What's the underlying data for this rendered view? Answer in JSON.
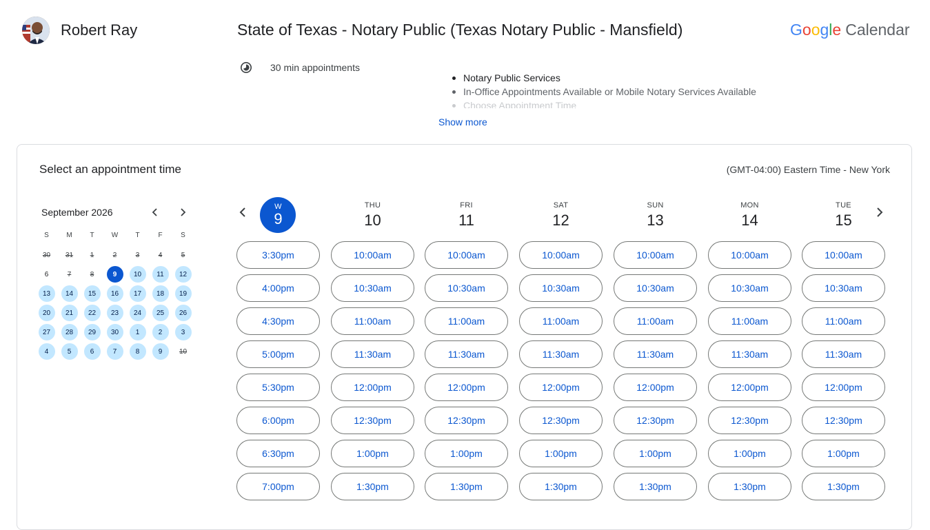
{
  "host": {
    "name": "Robert Ray"
  },
  "event": {
    "title": "State of Texas - Notary Public (Texas Notary Public - Mansfield)",
    "duration": "30 min appointments",
    "description": [
      "Notary Public Services",
      "In-Office Appointments Available or Mobile Notary Services Available",
      "Choose Appointment Time"
    ],
    "show_more": "Show more"
  },
  "brand": {
    "google_letters": [
      "G",
      "o",
      "o",
      "g",
      "l",
      "e"
    ],
    "product": "Calendar"
  },
  "booking": {
    "title": "Select an appointment time",
    "timezone": "(GMT-04:00) Eastern Time - New York"
  },
  "mini_calendar": {
    "month_label": "September 2026",
    "weekdays": [
      "S",
      "M",
      "T",
      "W",
      "T",
      "F",
      "S"
    ],
    "weeks": [
      [
        {
          "d": "30",
          "s": "past"
        },
        {
          "d": "31",
          "s": "past"
        },
        {
          "d": "1",
          "s": "past"
        },
        {
          "d": "2",
          "s": "past"
        },
        {
          "d": "3",
          "s": "past"
        },
        {
          "d": "4",
          "s": "past"
        },
        {
          "d": "5",
          "s": "past"
        }
      ],
      [
        {
          "d": "6",
          "s": "plain"
        },
        {
          "d": "7",
          "s": "past"
        },
        {
          "d": "8",
          "s": "past"
        },
        {
          "d": "9",
          "s": "selected"
        },
        {
          "d": "10",
          "s": "available"
        },
        {
          "d": "11",
          "s": "available"
        },
        {
          "d": "12",
          "s": "available"
        }
      ],
      [
        {
          "d": "13",
          "s": "available"
        },
        {
          "d": "14",
          "s": "available"
        },
        {
          "d": "15",
          "s": "available"
        },
        {
          "d": "16",
          "s": "available"
        },
        {
          "d": "17",
          "s": "available"
        },
        {
          "d": "18",
          "s": "available"
        },
        {
          "d": "19",
          "s": "available"
        }
      ],
      [
        {
          "d": "20",
          "s": "available"
        },
        {
          "d": "21",
          "s": "available"
        },
        {
          "d": "22",
          "s": "available"
        },
        {
          "d": "23",
          "s": "available"
        },
        {
          "d": "24",
          "s": "available"
        },
        {
          "d": "25",
          "s": "available"
        },
        {
          "d": "26",
          "s": "available"
        }
      ],
      [
        {
          "d": "27",
          "s": "available"
        },
        {
          "d": "28",
          "s": "available"
        },
        {
          "d": "29",
          "s": "available"
        },
        {
          "d": "30",
          "s": "available"
        },
        {
          "d": "1",
          "s": "available"
        },
        {
          "d": "2",
          "s": "available"
        },
        {
          "d": "3",
          "s": "available"
        }
      ],
      [
        {
          "d": "4",
          "s": "available"
        },
        {
          "d": "5",
          "s": "available"
        },
        {
          "d": "6",
          "s": "available"
        },
        {
          "d": "7",
          "s": "available"
        },
        {
          "d": "8",
          "s": "available"
        },
        {
          "d": "9",
          "s": "available"
        },
        {
          "d": "10",
          "s": "past"
        }
      ]
    ]
  },
  "days": [
    {
      "dow": "W",
      "num": "9",
      "today": true,
      "slots": [
        "3:30pm",
        "4:00pm",
        "4:30pm",
        "5:00pm",
        "5:30pm",
        "6:00pm",
        "6:30pm",
        "7:00pm"
      ]
    },
    {
      "dow": "THU",
      "num": "10",
      "today": false,
      "slots": [
        "10:00am",
        "10:30am",
        "11:00am",
        "11:30am",
        "12:00pm",
        "12:30pm",
        "1:00pm",
        "1:30pm"
      ]
    },
    {
      "dow": "FRI",
      "num": "11",
      "today": false,
      "slots": [
        "10:00am",
        "10:30am",
        "11:00am",
        "11:30am",
        "12:00pm",
        "12:30pm",
        "1:00pm",
        "1:30pm"
      ]
    },
    {
      "dow": "SAT",
      "num": "12",
      "today": false,
      "slots": [
        "10:00am",
        "10:30am",
        "11:00am",
        "11:30am",
        "12:00pm",
        "12:30pm",
        "1:00pm",
        "1:30pm"
      ]
    },
    {
      "dow": "SUN",
      "num": "13",
      "today": false,
      "slots": [
        "10:00am",
        "10:30am",
        "11:00am",
        "11:30am",
        "12:00pm",
        "12:30pm",
        "1:00pm",
        "1:30pm"
      ]
    },
    {
      "dow": "MON",
      "num": "14",
      "today": false,
      "slots": [
        "10:00am",
        "10:30am",
        "11:00am",
        "11:30am",
        "12:00pm",
        "12:30pm",
        "1:00pm",
        "1:30pm"
      ]
    },
    {
      "dow": "TUE",
      "num": "15",
      "today": false,
      "slots": [
        "10:00am",
        "10:30am",
        "11:00am",
        "11:30am",
        "12:00pm",
        "12:30pm",
        "1:00pm",
        "1:30pm"
      ]
    }
  ],
  "colors": {
    "accent": "#0b57d0",
    "available_day": "#c2e7ff",
    "border": "#dadce0"
  },
  "icons": {
    "duration": "timelapse-icon",
    "prev": "chevron-left-icon",
    "next": "chevron-right-icon"
  }
}
